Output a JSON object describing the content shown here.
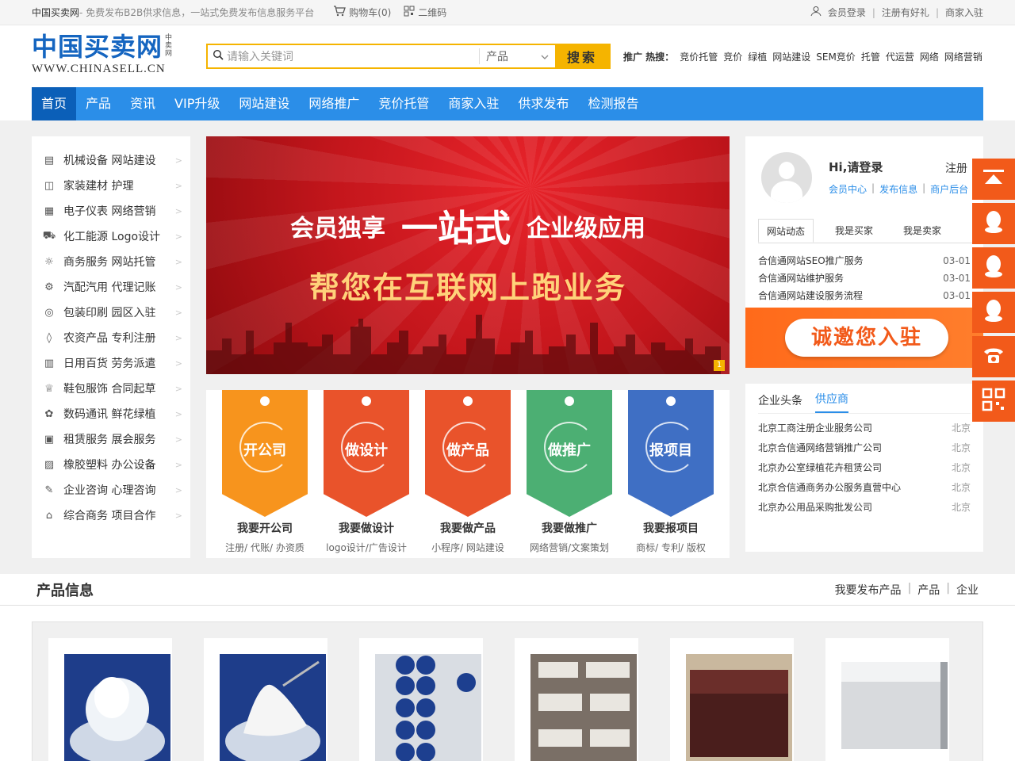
{
  "topbar": {
    "site": "中国买卖网",
    "slogan": " - 免费发布B2B供求信息，一站式免费发布信息服务平台",
    "cart": "购物车(0)",
    "qrcode": "二维码",
    "login": "会员登录",
    "register": "注册有好礼",
    "merchant": "商家入驻"
  },
  "logo": {
    "cn": "中国买卖网",
    "vertical": "中卖网",
    "en": "WWW.CHINASELL.CN"
  },
  "search": {
    "placeholder": "请输入关键词",
    "category": "产品",
    "button": "搜索"
  },
  "hot": {
    "label": "推广 热搜：",
    "items": [
      "竞价托管",
      "竞价",
      "绿植",
      "网站建设",
      "SEM竞价",
      "托管",
      "代运营",
      "网络",
      "网络营销"
    ]
  },
  "nav": [
    "首页",
    "产品",
    "资讯",
    "VIP升级",
    "网站建设",
    "网络推广",
    "竞价托管",
    "商家入驻",
    "供求发布",
    "检测报告"
  ],
  "categories": [
    {
      "label": "机械设备 网站建设",
      "icon": "building-icon",
      "glyph": "▤"
    },
    {
      "label": "家装建材 护理",
      "icon": "lock-icon",
      "glyph": "◫"
    },
    {
      "label": "电子仪表 网络营销",
      "icon": "calendar-icon",
      "glyph": "▦"
    },
    {
      "label": "化工能源 Logo设计",
      "icon": "truck-icon",
      "glyph": "⛟"
    },
    {
      "label": "商务服务 网站托管",
      "icon": "bulb-icon",
      "glyph": "☼"
    },
    {
      "label": "汽配汽用 代理记账",
      "icon": "wrench-icon",
      "glyph": "⚙"
    },
    {
      "label": "包装印刷 园区入驻",
      "icon": "print-icon",
      "glyph": "◎"
    },
    {
      "label": "农资产品 专利注册",
      "icon": "drop-icon",
      "glyph": "◊"
    },
    {
      "label": "日用百货 劳务派遣",
      "icon": "shelf-icon",
      "glyph": "▥"
    },
    {
      "label": "鞋包服饰 合同起草",
      "icon": "shirt-icon",
      "glyph": "♕"
    },
    {
      "label": "数码通讯 鲜花绿植",
      "icon": "gear-icon",
      "glyph": "✿"
    },
    {
      "label": "租赁服务 展会服务",
      "icon": "chip-icon",
      "glyph": "▣"
    },
    {
      "label": "橡胶塑料 办公设备",
      "icon": "printer-icon",
      "glyph": "▨"
    },
    {
      "label": "企业咨询 心理咨询",
      "icon": "edit-icon",
      "glyph": "✎"
    },
    {
      "label": "综合商务 项目合作",
      "icon": "bank-icon",
      "glyph": "⌂"
    }
  ],
  "banner": {
    "line1_a": "会员独享",
    "line1_b": "一站式",
    "line1_c": "企业级应用",
    "line2": "帮您在互联网上跑业务",
    "page": "1"
  },
  "services": [
    {
      "tag": "开公司",
      "title": "我要开公司",
      "desc": "注册/ 代账/ 办资质",
      "color": "#f7941d"
    },
    {
      "tag": "做设计",
      "title": "我要做设计",
      "desc": "logo设计/广告设计",
      "color": "#e9532b"
    },
    {
      "tag": "做产品",
      "title": "我要做产品",
      "desc": "小程序/ 网站建设",
      "color": "#e9532b"
    },
    {
      "tag": "做推广",
      "title": "我要做推广",
      "desc": "网络营销/文案策划",
      "color": "#4caf73"
    },
    {
      "tag": "报项目",
      "title": "我要报项目",
      "desc": "商标/ 专利/ 版权",
      "color": "#3f6fc4"
    }
  ],
  "user": {
    "greeting": "Hi,请登录",
    "register": "注册",
    "links": [
      "会员中心",
      "发布信息",
      "商户后台"
    ],
    "tabs": [
      "网站动态",
      "我是买家",
      "我是卖家"
    ],
    "news": [
      {
        "title": "合信通网站SEO推广服务",
        "date": "03-01"
      },
      {
        "title": "合信通网站维护服务",
        "date": "03-01"
      },
      {
        "title": "合信通网站建设服务流程",
        "date": "03-01"
      }
    ],
    "join": "诚邀您入驻"
  },
  "supply": {
    "tabs": [
      "企业头条",
      "供应商"
    ],
    "rows": [
      {
        "name": "北京工商注册企业服务公司",
        "city": "北京"
      },
      {
        "name": "北京合信通网络营销推广公司",
        "city": "北京"
      },
      {
        "name": "北京办公室绿植花卉租赁公司",
        "city": "北京"
      },
      {
        "name": "北京合信通商务办公服务直营中心",
        "city": "北京"
      },
      {
        "name": "北京办公用品采购批发公司",
        "city": "北京"
      }
    ]
  },
  "products": {
    "title": "产品信息",
    "links": [
      "我要发布产品",
      "产品",
      "企业"
    ]
  },
  "colors": {
    "nav": "#2b8ee8",
    "nav_active": "#0b5fb8",
    "search": "#f5b400",
    "float": "#f25a1a"
  }
}
